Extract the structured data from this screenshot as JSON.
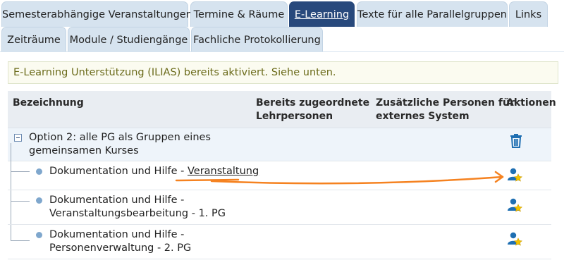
{
  "tabs": {
    "row1": [
      {
        "label": "Semesterabhängige Veranstaltungen"
      },
      {
        "label": "Termine & Räume"
      },
      {
        "label": "E-Learning",
        "active": true
      },
      {
        "label": "Texte für alle Parallelgruppen"
      },
      {
        "label": "Links"
      }
    ],
    "row2": [
      {
        "label": "Zeiträume"
      },
      {
        "label": "Module / Studiengänge"
      },
      {
        "label": "Fachliche Protokollierung"
      }
    ]
  },
  "info_message": "E-Learning Unterstützung (ILIAS) bereits aktiviert. Siehe unten.",
  "table": {
    "headers": {
      "name": "Bezeichnung",
      "teachers_line1": "Bereits zugeordnete",
      "teachers_line2": "Lehrpersonen",
      "external_line1": "Zusätzliche Personen für",
      "external_line2": "externes System",
      "actions": "Aktionen"
    },
    "group": {
      "label_line1": "Option 2: alle PG als Gruppen eines",
      "label_line2": "gemeinsamen Kurses"
    },
    "rows": [
      {
        "line1_prefix": "Dokumentation und Hilfe - ",
        "line1_link": "Veranstaltung"
      },
      {
        "line1": "Dokumentation und Hilfe -",
        "line2": "Veranstaltungsbearbeitung - 1. PG"
      },
      {
        "line1": "Dokumentation und Hilfe -",
        "line2": "Personenverwaltung - 2. PG"
      }
    ]
  },
  "colors": {
    "tab_active": "#28497c",
    "tab_inactive": "#d6e3ef",
    "info_text": "#6b6b1a",
    "icon_blue": "#1f6fb2",
    "star": "#f2c200",
    "annotation": "#f58220"
  },
  "icons": {
    "delete": "trash-icon",
    "assign": "user-star-icon"
  }
}
